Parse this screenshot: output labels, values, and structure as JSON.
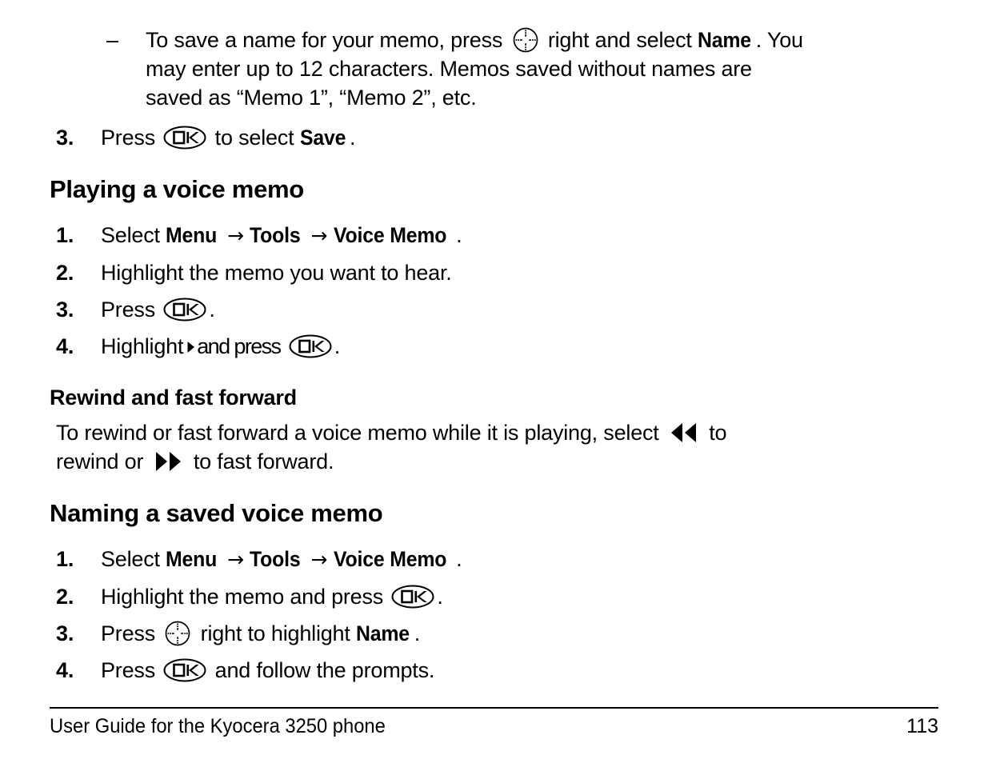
{
  "document": {
    "type": "user-guide-page",
    "page_number": "113",
    "footer_text": "User Guide for the Kyocera 3250 phone"
  },
  "content": {
    "sub_bullet": {
      "dash": "–",
      "line1_pre": "To save a name for your memo, press",
      "line1_mid": "right and select",
      "line1_label": "Name",
      "line1_post": ". You",
      "line2": "may enter up to 12 characters. Memos saved without names are",
      "line3": "saved as “Memo 1”, “Memo 2”, etc."
    },
    "step_save": {
      "number": "3.",
      "pre": "Press",
      "mid": "to select",
      "label": "Save",
      "post": "."
    },
    "playing_section": {
      "heading": "Playing a voice memo",
      "steps": [
        {
          "number": "1.",
          "pre": "Select",
          "label1": "Menu",
          "arrow1": "→",
          "label2": "Tools",
          "arrow2": "→",
          "label3": "Voice Memo",
          "post": "."
        },
        {
          "number": "2.",
          "text": "Highlight the memo you want to hear."
        },
        {
          "number": "3.",
          "pre": "Press",
          "post": "."
        },
        {
          "number": "4.",
          "pre": "Highlight",
          "mid": "and press",
          "post": "."
        }
      ]
    },
    "rewind_section": {
      "heading": "Rewind and fast forward",
      "para_part1": "To rewind or fast forward a voice memo while it is playing, select",
      "para_part2": "to",
      "para_part3": "rewind or",
      "para_part4": "to fast forward."
    },
    "naming_section": {
      "heading": "Naming a saved voice memo",
      "steps": [
        {
          "number": "1.",
          "pre": "Select",
          "label1": "Menu",
          "arrow1": "→",
          "label2": "Tools",
          "arrow2": "→",
          "label3": "Voice Memo",
          "post": "."
        },
        {
          "number": "2.",
          "pre": "Highlight the memo and press",
          "post": "."
        },
        {
          "number": "3.",
          "pre": "Press",
          "mid": "right to highlight",
          "label": "Name",
          "post": "."
        },
        {
          "number": "4.",
          "pre": "Press",
          "post": "and follow the prompts."
        }
      ]
    }
  },
  "icons": {
    "ok_key": "ok-key-icon",
    "nav_key": "navigation-key-icon",
    "play": "play-triangle-icon",
    "rewind": "rewind-double-left-icon",
    "fast_forward": "fast-forward-double-right-icon"
  },
  "colors": {
    "ink": "#000000",
    "paper": "#ffffff"
  }
}
